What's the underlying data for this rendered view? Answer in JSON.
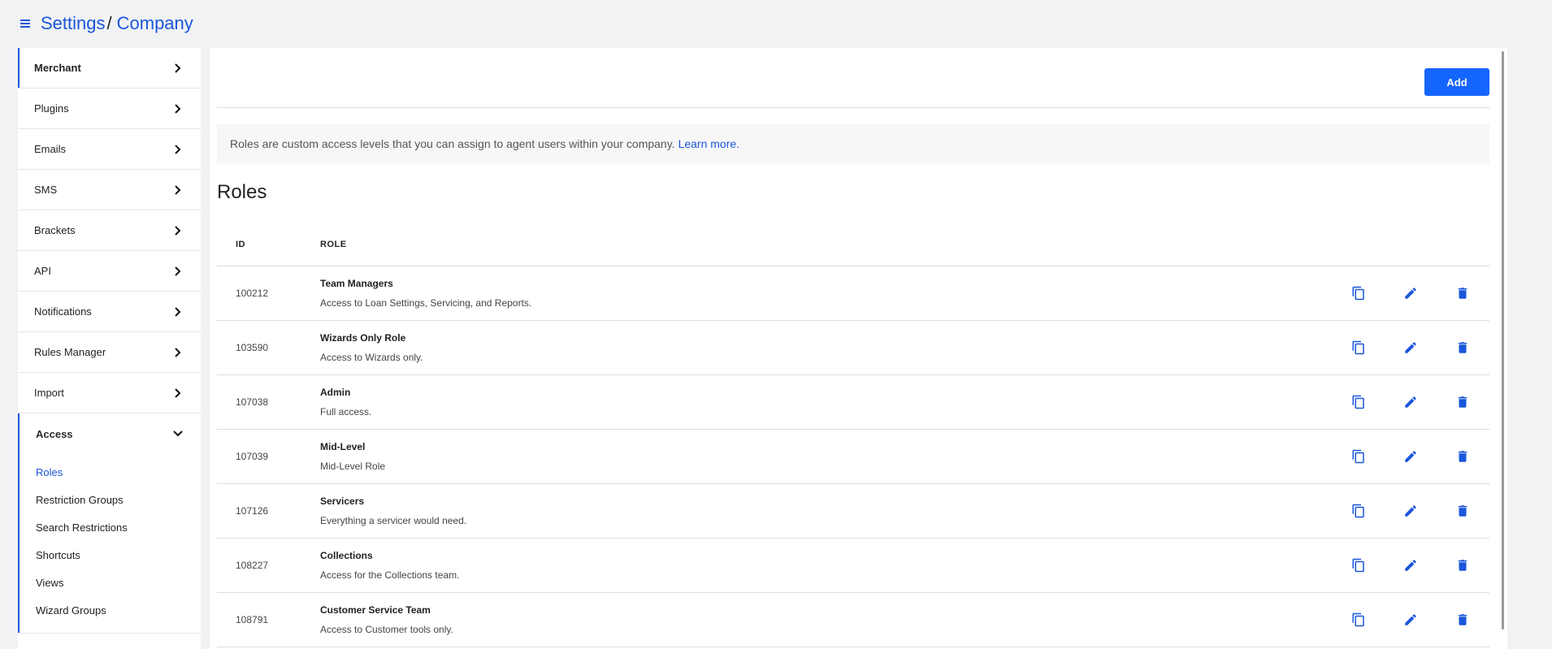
{
  "header": {
    "breadcrumb": [
      "Settings",
      "Company"
    ],
    "separator": "/"
  },
  "colors": {
    "accent": "#1a56db",
    "button": "#1565ff"
  },
  "sidebar": {
    "items": [
      {
        "label": "Merchant",
        "icon": "chevron-right-icon"
      },
      {
        "label": "Plugins",
        "icon": "chevron-right-icon"
      },
      {
        "label": "Emails",
        "icon": "chevron-right-icon"
      },
      {
        "label": "SMS",
        "icon": "chevron-right-icon"
      },
      {
        "label": "Brackets",
        "icon": "chevron-right-icon"
      },
      {
        "label": "API",
        "icon": "chevron-right-icon"
      },
      {
        "label": "Notifications",
        "icon": "chevron-right-icon"
      },
      {
        "label": "Rules Manager",
        "icon": "chevron-right-icon"
      },
      {
        "label": "Import",
        "icon": "chevron-right-icon"
      }
    ],
    "access": {
      "label": "Access",
      "icon": "chevron-down-icon",
      "subitems": [
        "Roles",
        "Restriction Groups",
        "Search Restrictions",
        "Shortcuts",
        "Views",
        "Wizard Groups"
      ]
    }
  },
  "main": {
    "add_label": "Add",
    "info_text": "Roles are custom access levels that you can assign to agent users within your company.",
    "info_link": "Learn more.",
    "title": "Roles",
    "columns": {
      "id": "ID",
      "role": "ROLE"
    },
    "rows": [
      {
        "id": "100212",
        "name": "Team Managers",
        "desc": "Access to Loan Settings, Servicing, and Reports."
      },
      {
        "id": "103590",
        "name": "Wizards Only Role",
        "desc": "Access to Wizards only."
      },
      {
        "id": "107038",
        "name": "Admin",
        "desc": "Full access."
      },
      {
        "id": "107039",
        "name": "Mid-Level",
        "desc": "Mid-Level Role"
      },
      {
        "id": "107126",
        "name": "Servicers",
        "desc": "Everything a servicer would need."
      },
      {
        "id": "108227",
        "name": "Collections",
        "desc": "Access for the Collections team."
      },
      {
        "id": "108791",
        "name": "Customer Service Team",
        "desc": "Access to Customer tools only."
      }
    ],
    "row_actions": [
      "copy-icon",
      "edit-icon",
      "delete-icon"
    ]
  }
}
